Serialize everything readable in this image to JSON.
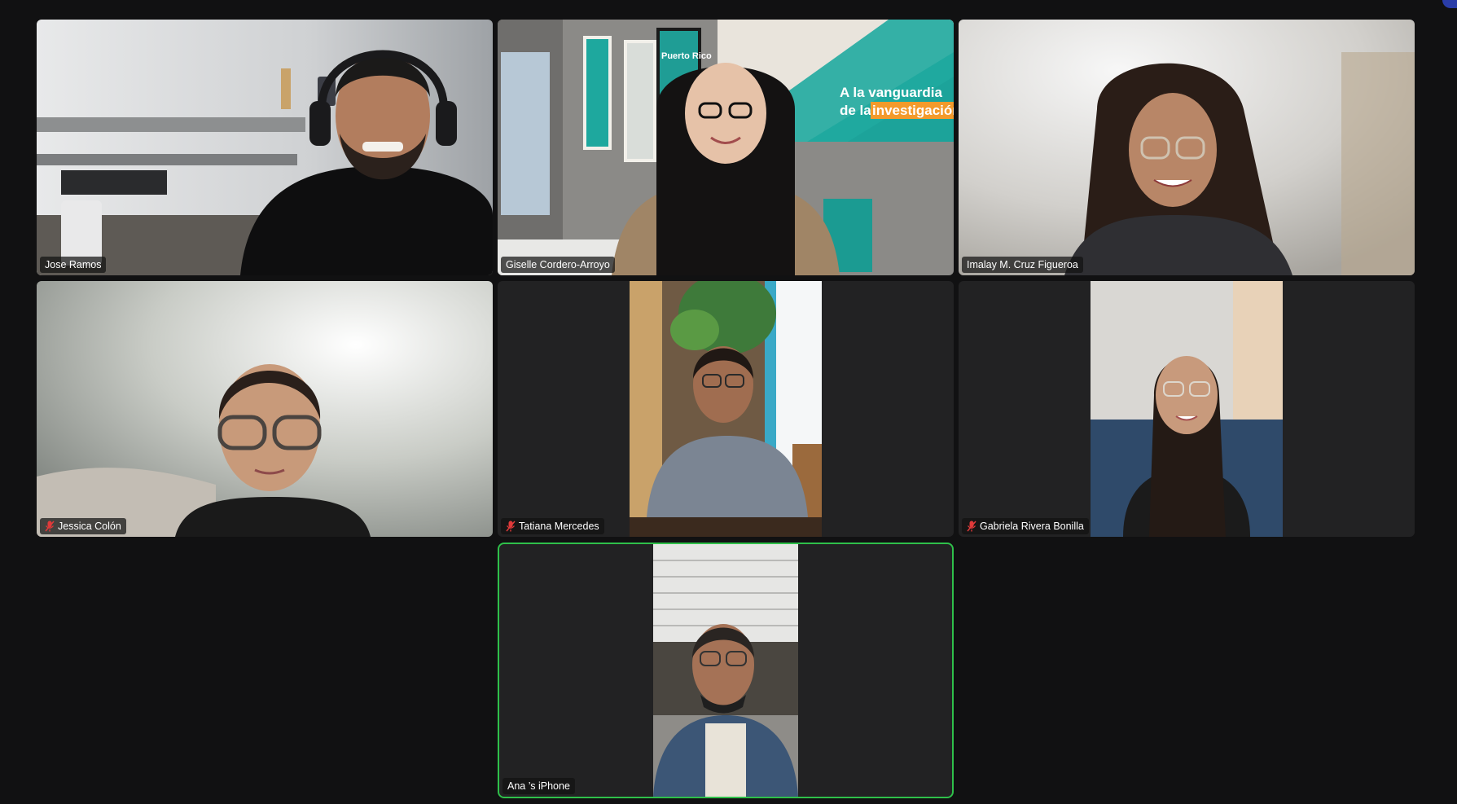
{
  "participants": [
    {
      "name": "Jose Ramos",
      "muted": false
    },
    {
      "name": "Giselle Cordero-Arroyo",
      "muted": false
    },
    {
      "name": "Imalay M. Cruz Figueroa",
      "muted": false
    },
    {
      "name": "Jessica Colón",
      "muted": true
    },
    {
      "name": "Tatiana Mercedes",
      "muted": true
    },
    {
      "name": "Gabriela Rivera Bonilla",
      "muted": true
    },
    {
      "name": "Ana ’s iPhone",
      "muted": false,
      "active_speaker": true
    }
  ],
  "background_posters": {
    "poster_title": "Puerto Rico",
    "banner_line1": "A la vanguardia",
    "banner_line2_prefix": "de la",
    "banner_line2_highlight": "investigación"
  },
  "colors": {
    "background": "#111112",
    "tile": "#222223",
    "active_speaker_border": "#2fc04a",
    "mute_icon": "#e03a3a",
    "name_text": "#ffffff"
  },
  "icons": {
    "mute": "microphone-muted-icon"
  }
}
